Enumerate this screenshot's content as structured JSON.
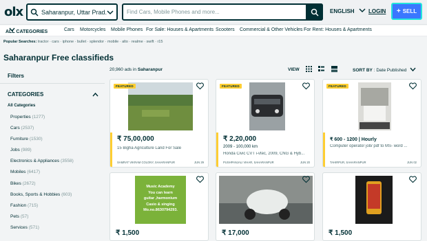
{
  "header": {
    "logo": "olx",
    "location": "Saharanpur, Uttar Prad...",
    "search_placeholder": "Find Cars, Mobile Phones and more...",
    "language": "ENGLISH",
    "login": "LOGIN",
    "sell": "SELL"
  },
  "catbar": {
    "all_categories": "ALL CATEGORIES",
    "items": [
      "Cars",
      "Motorcycles",
      "Mobile Phones",
      "For Sale: Houses & Apartments",
      "Scooters",
      "Commercial & Other Vehicles",
      "For Rent: Houses & Apartments"
    ]
  },
  "popular": {
    "label": "Popular Searches:",
    "terms": "tractor · cars · iphone · bullet · splendor · mobile · alto · realme · swift · r15"
  },
  "page_title": "Saharanpur Free classifieds",
  "sidebar": {
    "filters": "Filters",
    "categories_label": "CATEGORIES",
    "all_categories": "All Categories",
    "items": [
      {
        "label": "Properties",
        "count": "(1277)"
      },
      {
        "label": "Cars",
        "count": "(2537)"
      },
      {
        "label": "Furniture",
        "count": "(1530)"
      },
      {
        "label": "Jobs",
        "count": "(989)"
      },
      {
        "label": "Electronics & Appliances",
        "count": "(3558)"
      },
      {
        "label": "Mobiles",
        "count": "(6417)"
      },
      {
        "label": "Bikes",
        "count": "(2672)"
      },
      {
        "label": "Books, Sports & Hobbies",
        "count": "(603)"
      },
      {
        "label": "Fashion",
        "count": "(715)"
      },
      {
        "label": "Pets",
        "count": "(57)"
      },
      {
        "label": "Services",
        "count": "(571)"
      }
    ]
  },
  "results": {
    "count": "20,960",
    "count_text": "ads in",
    "place": "Saharanpur",
    "view_label": "VIEW",
    "sort_label": "SORT BY",
    "sort_value": "Date Published"
  },
  "listings": [
    {
      "badge": "FEATURED",
      "price": "₹ 75,00,000",
      "sub": "",
      "desc": "15 Bigha Agriculture Land For Sale",
      "location": "SAMRAT VIKRAM COLONY, SAHARANPUR",
      "date": "JUN 29"
    },
    {
      "badge": "FEATURED",
      "price": "₹ 2,20,000",
      "sub": "2009 - 100,000 km",
      "desc": "Honda Civic CVT i-vtec, 2009, CNG & Hyb...",
      "location": "PUSHPANJALI VIHAR, SAHARANPUR",
      "date": "JUN 20"
    },
    {
      "badge": "FEATURED",
      "price": "₹ 600 - 1200 | Hourly",
      "sub": "",
      "desc": "Computer operator job/ pdf to MS- word ...",
      "location": "TAHIRPUR, SAHARANPUR",
      "date": "JUN 02"
    },
    {
      "badge": "",
      "price": "₹ 1,500",
      "sub": "",
      "desc": "",
      "location": "",
      "date": "",
      "image_text": "Music Academy\nYou can learn\nguitar ,harmonium\nCasio & singing\nMo.no.8630794293."
    },
    {
      "badge": "",
      "price": "₹ 17,000",
      "sub": "",
      "desc": "",
      "location": "",
      "date": ""
    },
    {
      "badge": "",
      "price": "₹ 1,500",
      "sub": "",
      "desc": "",
      "location": "",
      "date": ""
    }
  ],
  "colors": {
    "brand": "#002f34",
    "accent": "#3a77ff",
    "featured": "#ffce32"
  }
}
